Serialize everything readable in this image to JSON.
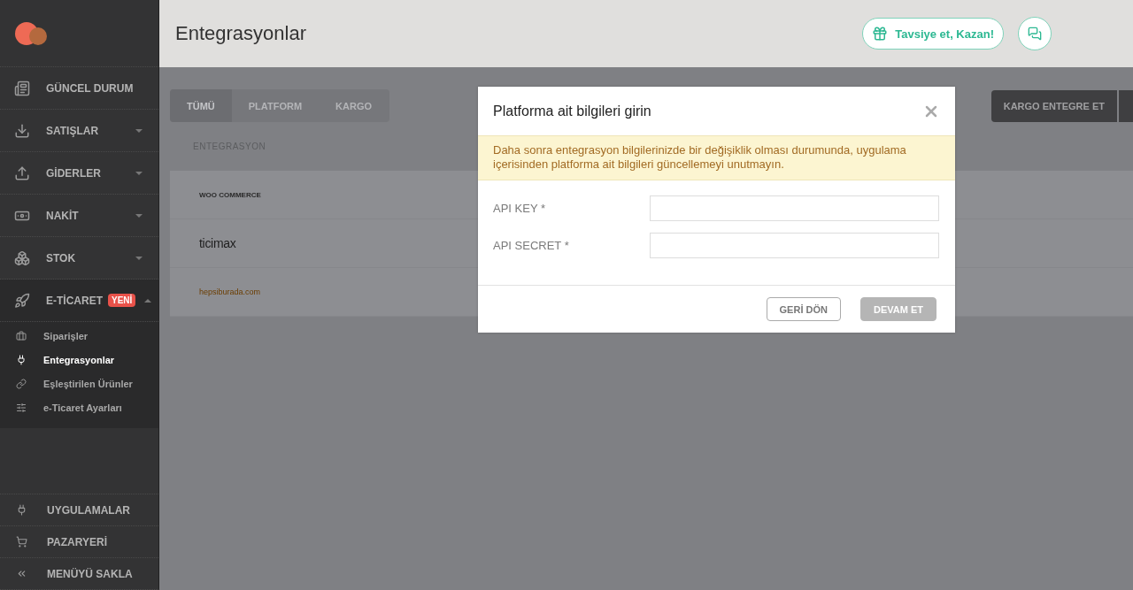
{
  "sidebar": {
    "items": [
      {
        "label": "GÜNCEL DURUM",
        "kind": "link"
      },
      {
        "label": "SATIŞLAR",
        "kind": "group",
        "expanded": false
      },
      {
        "label": "GİDERLER",
        "kind": "group",
        "expanded": false
      },
      {
        "label": "NAKİT",
        "kind": "group",
        "expanded": false
      },
      {
        "label": "STOK",
        "kind": "group",
        "expanded": false
      },
      {
        "label": "E-TİCARET",
        "kind": "group",
        "expanded": true,
        "badge": "YENİ",
        "children": [
          {
            "label": "Siparişler",
            "selected": false
          },
          {
            "label": "Entegrasyonlar",
            "selected": true
          },
          {
            "label": "Eşleştirilen Ürünler",
            "selected": false
          },
          {
            "label": "e-Ticaret Ayarları",
            "selected": false
          }
        ]
      }
    ],
    "bottom_items": [
      {
        "label": "UYGULAMALAR"
      },
      {
        "label": "PAZARYERİ"
      },
      {
        "label": "MENÜYÜ SAKLA"
      }
    ]
  },
  "header": {
    "title": "Entegrasyonlar",
    "referral_button": "Tavsiye et, Kazan!"
  },
  "tabs": [
    {
      "label": "TÜMÜ",
      "selected": true
    },
    {
      "label": "PLATFORM",
      "selected": false
    },
    {
      "label": "KARGO",
      "selected": false
    }
  ],
  "actions": [
    "KARGO ENTEGRE ET"
  ],
  "table": {
    "columns": [
      "ENTEGRASYON"
    ],
    "rows": [
      {
        "logo": "WOO COMMERCE",
        "kind": "woo"
      },
      {
        "logo": "ticimax",
        "kind": "ticimax"
      },
      {
        "logo": "hepsiburada.com",
        "kind": "hepsi"
      }
    ]
  },
  "modal": {
    "title": "Platforma ait bilgileri girin",
    "notice": "Daha sonra entegrasyon bilgilerinizde bir değişiklik olması durumunda, uygulama içerisinden platforma ait bilgileri güncellemeyi unutmayın.",
    "fields": [
      {
        "label": "API KEY *"
      },
      {
        "label": "API SECRET *"
      }
    ],
    "buttons": [
      {
        "label": "GERİ DÖN",
        "disabled": false
      },
      {
        "label": "DEVAM ET",
        "disabled": true
      }
    ]
  }
}
